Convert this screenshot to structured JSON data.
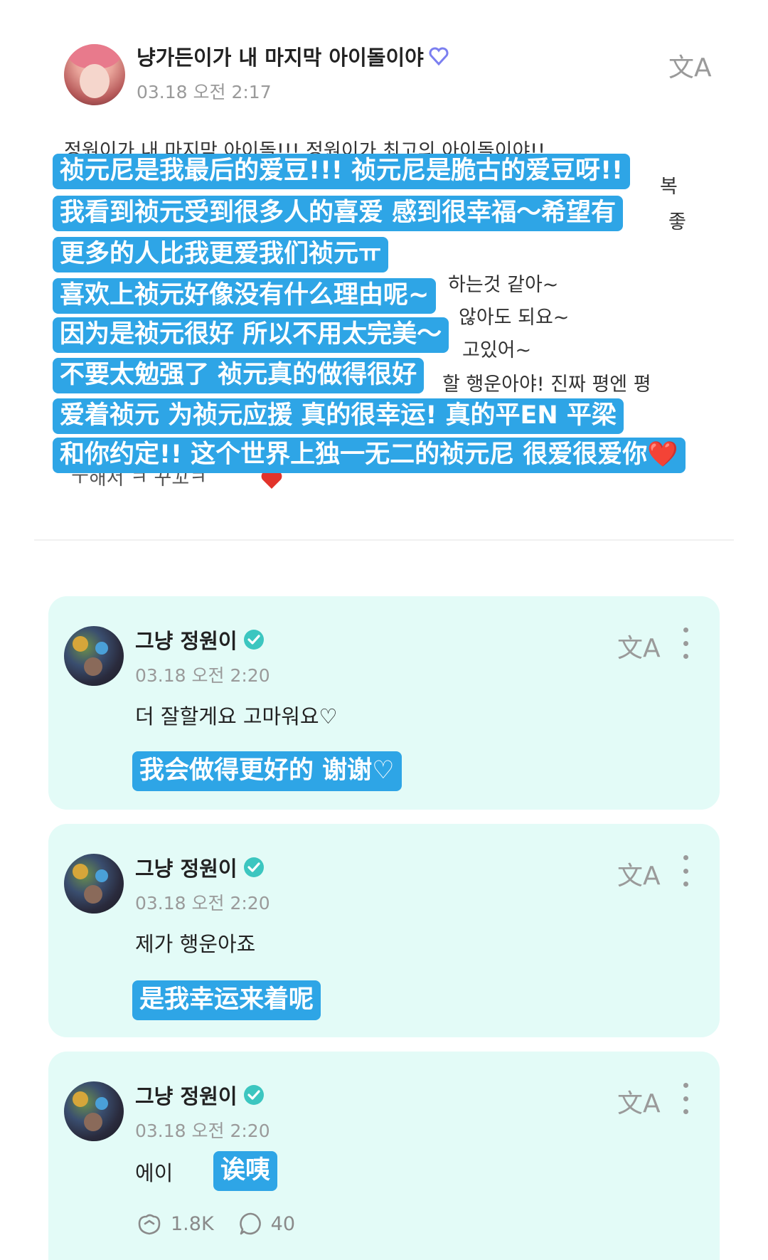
{
  "post": {
    "author": "냥가든이가 내 마지막 아이돌이야",
    "date": "03.18 오전 2:17",
    "translate_icon": "文A",
    "korean_lines": [
      "정원이가 내 마지막 아이돌!!! 정원이가 최고의 아이돌이야!!",
      "복",
      "좋",
      "하는것 같아~",
      "않아도 되요~",
      "고있어~",
      "할 행운아야! 진짜 평엔 평",
      "ㅜ해서 ㅋ 꾸꼬ㅋ"
    ],
    "translation_lines": [
      "祯元尼是我最后的爱豆!!! 祯元尼是脆古的爱豆呀!!",
      "我看到祯元受到很多人的喜爱 感到很幸福～希望有",
      "更多的人比我更爱我们祯元ㅠ",
      "喜欢上祯元好像没有什么理由呢~",
      "因为是祯元很好 所以不用太完美～",
      "不要太勉强了 祯元真的做得很好",
      "爱着祯元 为祯元应援 真的很幸运! 真的平EN 平梁",
      "和你约定!! 这个世界上独一无二的祯元尼 很爱很爱你❤️"
    ]
  },
  "comments": [
    {
      "name": "그냥 정원이",
      "date": "03.18 오전 2:20",
      "text": "더 잘할게요 고마워요♡",
      "translation": "我会做得更好的 谢谢♡"
    },
    {
      "name": "그냥 정원이",
      "date": "03.18 오전 2:20",
      "text": "제가 행운아죠",
      "translation": "是我幸运来着呢"
    },
    {
      "name": "그냥 정원이",
      "date": "03.18 오전 2:20",
      "text": "에이",
      "translation": "诶咦",
      "stats": {
        "likes": "1.8K",
        "replies": "40"
      }
    }
  ],
  "colors": {
    "highlight": "#2ea5e6",
    "card_bg": "#e3fbf7",
    "verified": "#3cc6c0",
    "heart_badge": "#7b7ff0"
  },
  "icons": {
    "translate": "translate-icon",
    "more": "more-vertical-icon",
    "verified": "verified-badge-icon",
    "like": "like-hands-icon",
    "reply": "comment-bubble-icon"
  }
}
